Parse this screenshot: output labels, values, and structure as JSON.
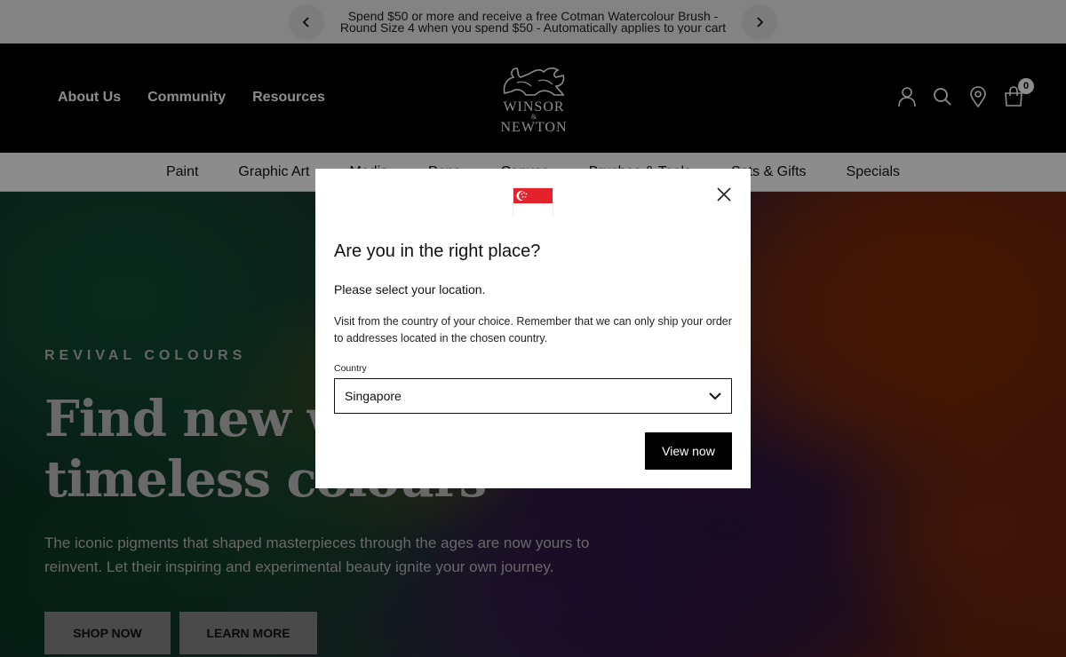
{
  "announcement": {
    "line1": "Spend $50 or more and receive a free Cotman Watercolour Brush -",
    "line2": "Round Size 4 when you spend $50 - Automatically applies to your cart",
    "prev_icon": "chevron-left-icon",
    "next_icon": "chevron-right-icon"
  },
  "header": {
    "nav": [
      "About Us",
      "Community",
      "Resources"
    ],
    "logo": {
      "line1": "WINSOR",
      "amp": "&",
      "line2": "NEWTON"
    },
    "icons": [
      "account-icon",
      "search-icon",
      "store-locator-icon",
      "cart-icon"
    ],
    "cart_count": "0"
  },
  "category_nav": [
    "Paint",
    "Graphic Art",
    "Media",
    "Pens",
    "Canvas",
    "Brushes & Tools",
    "Sets & Gifts",
    "Specials"
  ],
  "hero": {
    "eyebrow": "REVIVAL COLOURS",
    "title_line1": "Find new ways with",
    "title_line2": "timeless colours",
    "subtitle": "The iconic pigments that shaped masterpieces through the ages are now yours to reinvent. Let their inspiring and experimental beauty ignite your own journey.",
    "buttons": [
      "SHOP NOW",
      "LEARN MORE"
    ]
  },
  "modal": {
    "flag": "singapore-flag-icon",
    "title": "Are you in the right place?",
    "subtitle": "Please select your location.",
    "description": "Visit from the country of your choice. Remember that we can only ship your order to addresses located in the chosen country.",
    "country_label": "Country",
    "country_value": "Singapore",
    "button": "View now"
  },
  "colors": {
    "announcement_bg": "#eeeeee",
    "header_bg": "#000000",
    "flag_red": "#e4222e",
    "button_bg": "#000000"
  }
}
